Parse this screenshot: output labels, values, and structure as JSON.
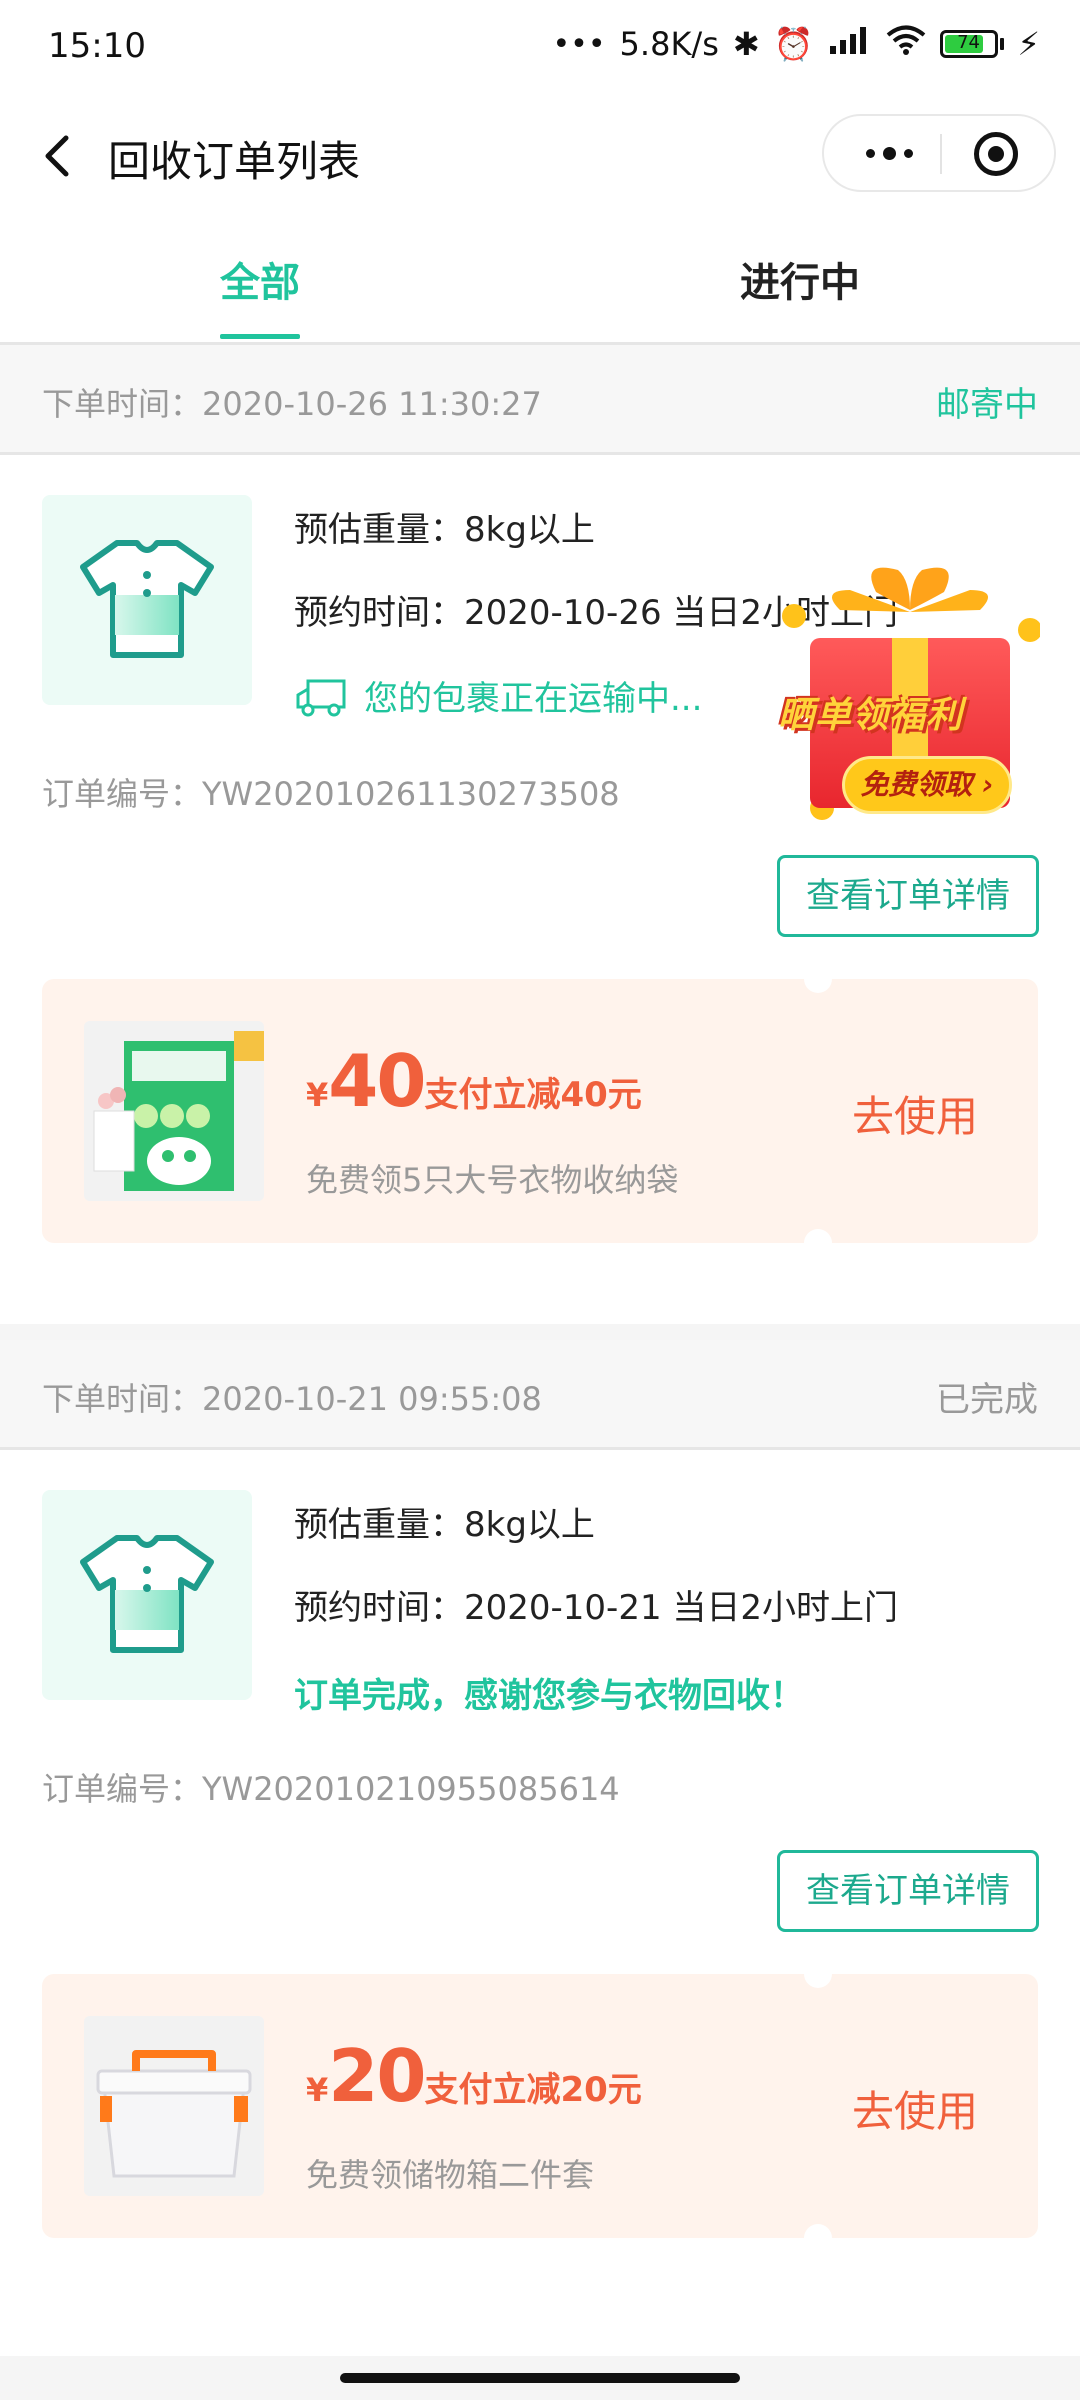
{
  "status_bar": {
    "time": "15:10",
    "network_speed": "5.8K/s",
    "battery": "74"
  },
  "nav": {
    "title": "回收订单列表"
  },
  "tabs": [
    {
      "label": "全部",
      "active": true
    },
    {
      "label": "进行中",
      "active": false
    }
  ],
  "orders": [
    {
      "time_label": "下单时间：",
      "time": "2020-10-26 11:30:27",
      "status": "邮寄中",
      "status_color": "#20c49d",
      "weight": "预估重量：8kg以上",
      "appointment": "预约时间：2020-10-26 当日2小时上门",
      "message": "您的包裹正在运输中...",
      "order_no": "订单编号：YW202010261130273508",
      "detail_button": "查看订单详情",
      "coupon": {
        "yen": "¥",
        "amount": "40",
        "desc": "支付立减40元",
        "sub": "免费领5只大号衣物收纳袋",
        "action": "去使用"
      }
    },
    {
      "time_label": "下单时间：",
      "time": "2020-10-21 09:55:08",
      "status": "已完成",
      "status_color": "#999999",
      "weight": "预估重量：8kg以上",
      "appointment": "预约时间：2020-10-21 当日2小时上门",
      "message": "订单完成，感谢您参与衣物回收！",
      "order_no": "订单编号：YW202010210955085614",
      "detail_button": "查看订单详情",
      "coupon": {
        "yen": "¥",
        "amount": "20",
        "desc": "支付立减20元",
        "sub": "免费领储物箱二件套",
        "action": "去使用"
      }
    }
  ],
  "gift_banner": {
    "title": "晒单领福利",
    "button": "免费领取 ›"
  },
  "colors": {
    "accent": "#20c49d",
    "coupon_red": "#f0603c",
    "coupon_bg": "#fff3ec"
  }
}
